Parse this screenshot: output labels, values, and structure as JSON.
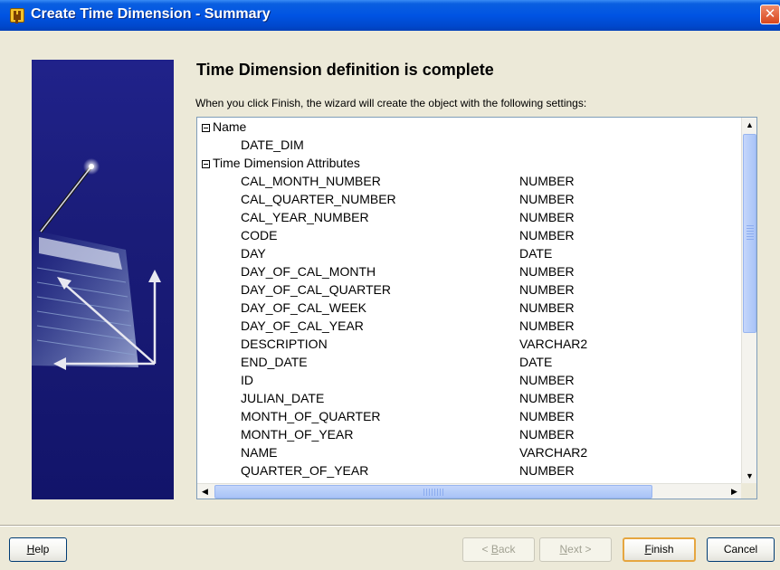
{
  "window": {
    "title": "Create Time Dimension - Summary"
  },
  "heading": "Time Dimension definition is complete",
  "instruction": "When you click Finish, the wizard will create the object with the following settings:",
  "tree": {
    "name_group": {
      "label": "Name",
      "value": "DATE_DIM"
    },
    "attributes_group": {
      "label": "Time Dimension Attributes",
      "attributes": [
        {
          "name": "CAL_MONTH_NUMBER",
          "type": "NUMBER"
        },
        {
          "name": "CAL_QUARTER_NUMBER",
          "type": "NUMBER"
        },
        {
          "name": "CAL_YEAR_NUMBER",
          "type": "NUMBER"
        },
        {
          "name": "CODE",
          "type": "NUMBER"
        },
        {
          "name": "DAY",
          "type": "DATE"
        },
        {
          "name": "DAY_OF_CAL_MONTH",
          "type": "NUMBER"
        },
        {
          "name": "DAY_OF_CAL_QUARTER",
          "type": "NUMBER"
        },
        {
          "name": "DAY_OF_CAL_WEEK",
          "type": "NUMBER"
        },
        {
          "name": "DAY_OF_CAL_YEAR",
          "type": "NUMBER"
        },
        {
          "name": "DESCRIPTION",
          "type": "VARCHAR2"
        },
        {
          "name": "END_DATE",
          "type": "DATE"
        },
        {
          "name": "ID",
          "type": "NUMBER"
        },
        {
          "name": "JULIAN_DATE",
          "type": "NUMBER"
        },
        {
          "name": "MONTH_OF_QUARTER",
          "type": "NUMBER"
        },
        {
          "name": "MONTH_OF_YEAR",
          "type": "NUMBER"
        },
        {
          "name": "NAME",
          "type": "VARCHAR2"
        },
        {
          "name": "QUARTER_OF_YEAR",
          "type": "NUMBER"
        }
      ]
    }
  },
  "buttons": {
    "help": {
      "label": "Help",
      "mnemonic": "H",
      "rest": "elp"
    },
    "back": {
      "label": "< Back",
      "mnemonic": "B",
      "pre": "< ",
      "rest": "ack"
    },
    "next": {
      "label": "Next >",
      "mnemonic": "N",
      "rest": "ext >"
    },
    "finish": {
      "label": "Finish",
      "mnemonic": "F",
      "rest": "inish"
    },
    "cancel": {
      "label": "Cancel"
    }
  },
  "colors": {
    "titlebar": "#0054e3",
    "side_panel": "#1a1c78",
    "dialog_bg": "#ece9d8",
    "default_button_border": "#e6a640"
  }
}
